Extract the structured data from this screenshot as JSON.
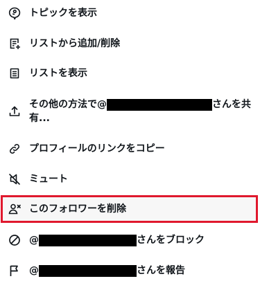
{
  "menu": {
    "items": [
      {
        "icon": "topic-icon",
        "label": "トピックを表示"
      },
      {
        "icon": "list-add-icon",
        "label": "リストから追加/削除"
      },
      {
        "icon": "list-icon",
        "label": "リストを表示"
      },
      {
        "icon": "share-icon",
        "label_prefix": "その他の方法で@",
        "label_suffix": "さんを共",
        "label_line2": "有..."
      },
      {
        "icon": "link-icon",
        "label": "プロフィールのリンクをコピー"
      },
      {
        "icon": "mute-icon",
        "label": "ミュート"
      },
      {
        "icon": "remove-follower-icon",
        "label": "このフォロワーを削除",
        "highlighted": true
      },
      {
        "icon": "block-icon",
        "label_prefix": "@",
        "label_suffix": "さんをブロック"
      },
      {
        "icon": "report-flag-icon",
        "label_prefix": "@",
        "label_suffix": "さんを報告"
      }
    ]
  },
  "colors": {
    "text": "#0f1419",
    "highlight_border": "#e0182d",
    "redaction": "#000000"
  }
}
